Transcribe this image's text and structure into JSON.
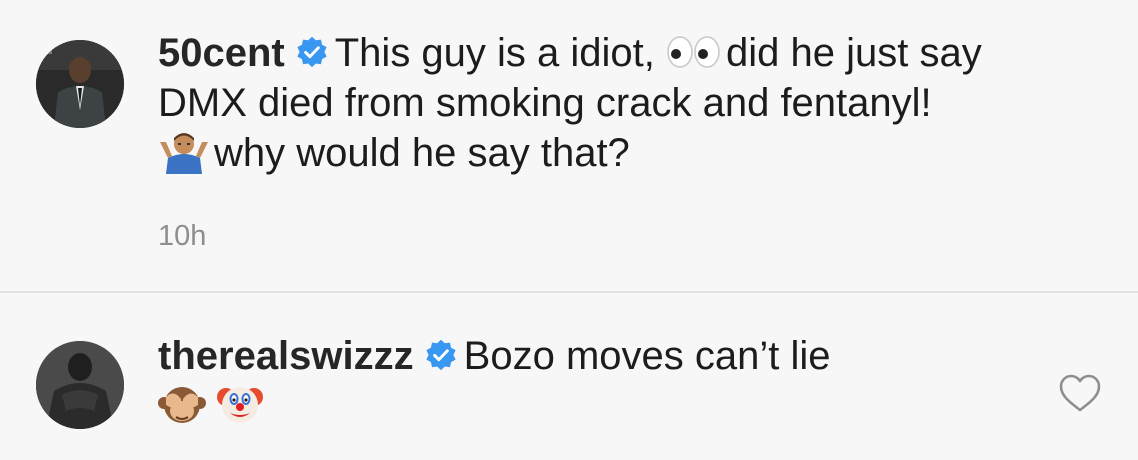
{
  "comments": [
    {
      "username": "50cent",
      "text_part1": "This guy is a idiot,",
      "text_part2": "did he just say DMX died from smoking crack and fentanyl!",
      "text_part3": "why would he say that?",
      "emojis": [
        "eyes-icon",
        "man-shrugging-icon"
      ],
      "timestamp": "10h",
      "verified": true
    },
    {
      "username": "therealswizzz",
      "text": "Bozo moves can’t lie",
      "emojis": [
        "see-no-evil-monkey-icon",
        "clown-face-icon"
      ],
      "verified": true
    }
  ],
  "colors": {
    "background": "#f7f7f7",
    "text": "#262626",
    "muted": "#8e8e8e",
    "verified_blue": "#3897f0"
  }
}
